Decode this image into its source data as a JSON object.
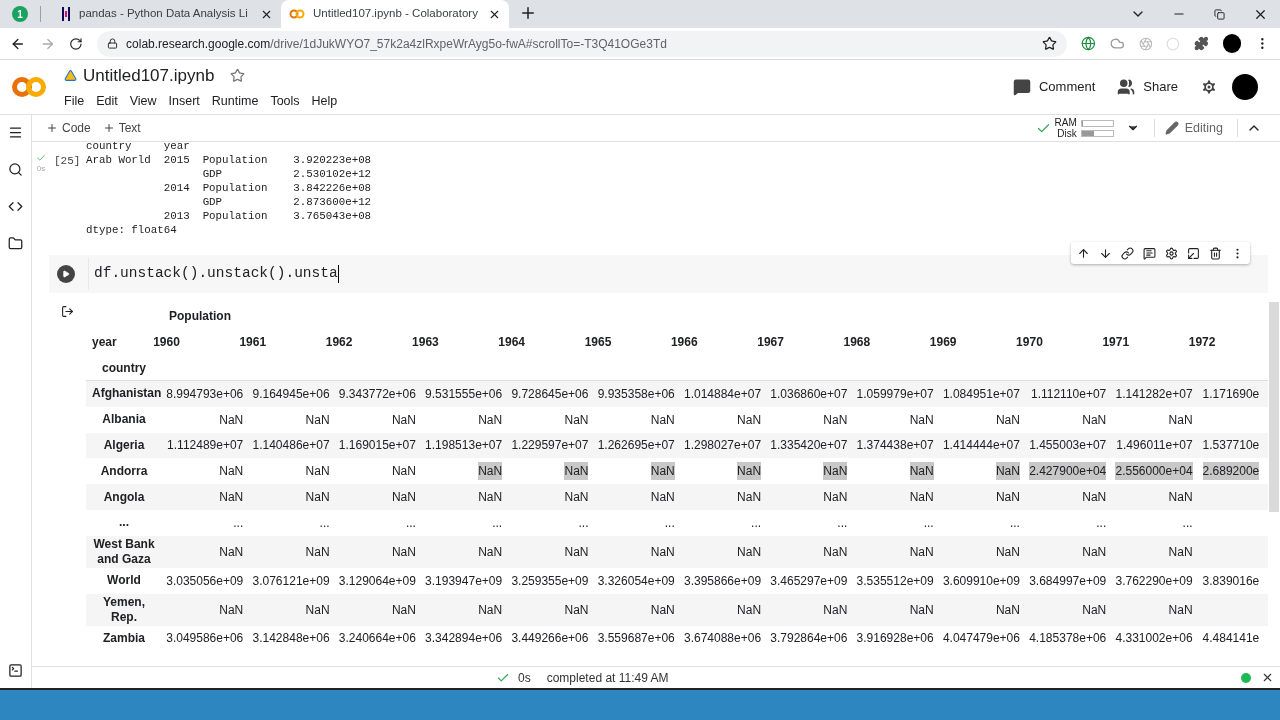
{
  "browser": {
    "pinned_badge": "1",
    "tabs": [
      {
        "title": "pandas - Python Data Analysis Li",
        "selected": false
      },
      {
        "title": "Untitled107.ipynb - Colaboratory",
        "selected": true
      }
    ],
    "url_host": "colab.research.google.com",
    "url_path": "/drive/1dJukWYO7_57k2a4zlRxpeWrAyg5o-fwA#scrollTo=-T3Q41OGe3Td"
  },
  "notebook": {
    "title": "Untitled107.ipynb",
    "menu": [
      "File",
      "Edit",
      "View",
      "Insert",
      "Runtime",
      "Tools",
      "Help"
    ],
    "actions": [
      {
        "kind": "comment",
        "label": "Comment"
      },
      {
        "kind": "share",
        "label": "Share"
      }
    ],
    "add_buttons": [
      {
        "label": "Code"
      },
      {
        "label": "Text"
      }
    ],
    "resources": [
      {
        "label": "RAM",
        "level": 0.05
      },
      {
        "label": "Disk",
        "level": 0.4
      }
    ],
    "mode": "Editing"
  },
  "previous_output": {
    "execution_count": "[25]",
    "duration": "0s",
    "lines": [
      "country     year",
      "Arab World  2015  Population    3.920223e+08",
      "                  GDP           2.530102e+12",
      "            2014  Population    3.842226e+08",
      "                  GDP           2.873600e+12",
      "            2013  Population    3.765043e+08",
      "dtype: float64"
    ]
  },
  "code_cell": {
    "code": "df.unstack().unstack().unsta"
  },
  "table": {
    "top_header": "Population",
    "column_axis": "year",
    "row_axis": "country",
    "columns": [
      "1960",
      "1961",
      "1962",
      "1963",
      "1964",
      "1965",
      "1966",
      "1967",
      "1968",
      "1969",
      "1970",
      "1971",
      "1972"
    ],
    "rows": [
      {
        "label": "Afghanistan",
        "cells": [
          "8.994793e+06",
          "9.164945e+06",
          "9.343772e+06",
          "9.531555e+06",
          "9.728645e+06",
          "9.935358e+06",
          "1.014884e+07",
          "1.036860e+07",
          "1.059979e+07",
          "1.084951e+07",
          "1.112110e+07",
          "1.141282e+07",
          "1.171690e"
        ],
        "highlighted": [
          false,
          false,
          false,
          false,
          false,
          false,
          false,
          false,
          false,
          false,
          false,
          false,
          false
        ]
      },
      {
        "label": "Albania",
        "cells": [
          "NaN",
          "NaN",
          "NaN",
          "NaN",
          "NaN",
          "NaN",
          "NaN",
          "NaN",
          "NaN",
          "NaN",
          "NaN",
          "NaN"
        ],
        "highlighted": [
          false,
          false,
          false,
          false,
          false,
          false,
          false,
          false,
          false,
          false,
          false,
          false
        ]
      },
      {
        "label": "Algeria",
        "cells": [
          "1.112489e+07",
          "1.140486e+07",
          "1.169015e+07",
          "1.198513e+07",
          "1.229597e+07",
          "1.262695e+07",
          "1.298027e+07",
          "1.335420e+07",
          "1.374438e+07",
          "1.414444e+07",
          "1.455003e+07",
          "1.496011e+07",
          "1.537710e"
        ],
        "highlighted": [
          false,
          false,
          false,
          false,
          false,
          false,
          false,
          false,
          false,
          false,
          false,
          false,
          false
        ]
      },
      {
        "label": "Andorra",
        "cells": [
          "NaN",
          "NaN",
          "NaN",
          "NaN",
          "NaN",
          "NaN",
          "NaN",
          "NaN",
          "NaN",
          "NaN",
          "2.427900e+04",
          "2.556000e+04",
          "2.689200e"
        ],
        "highlighted": [
          false,
          false,
          false,
          true,
          true,
          true,
          true,
          true,
          true,
          true,
          true,
          true,
          true
        ]
      },
      {
        "label": "Angola",
        "cells": [
          "NaN",
          "NaN",
          "NaN",
          "NaN",
          "NaN",
          "NaN",
          "NaN",
          "NaN",
          "NaN",
          "NaN",
          "NaN",
          "NaN"
        ],
        "highlighted": [
          false,
          false,
          false,
          false,
          false,
          false,
          false,
          false,
          false,
          false,
          false,
          false
        ]
      },
      {
        "label": "...",
        "cells": [
          "...",
          "...",
          "...",
          "...",
          "...",
          "...",
          "...",
          "...",
          "...",
          "...",
          "...",
          "..."
        ],
        "highlighted": [
          false,
          false,
          false,
          false,
          false,
          false,
          false,
          false,
          false,
          false,
          false,
          false
        ]
      },
      {
        "label": "West Bank and Gaza",
        "cells": [
          "NaN",
          "NaN",
          "NaN",
          "NaN",
          "NaN",
          "NaN",
          "NaN",
          "NaN",
          "NaN",
          "NaN",
          "NaN",
          "NaN"
        ],
        "highlighted": [
          false,
          false,
          false,
          false,
          false,
          false,
          false,
          false,
          false,
          false,
          false,
          false
        ]
      },
      {
        "label": "World",
        "cells": [
          "3.035056e+09",
          "3.076121e+09",
          "3.129064e+09",
          "3.193947e+09",
          "3.259355e+09",
          "3.326054e+09",
          "3.395866e+09",
          "3.465297e+09",
          "3.535512e+09",
          "3.609910e+09",
          "3.684997e+09",
          "3.762290e+09",
          "3.839016e"
        ],
        "highlighted": [
          false,
          false,
          false,
          false,
          false,
          false,
          false,
          false,
          false,
          false,
          false,
          false,
          false
        ]
      },
      {
        "label": "Yemen, Rep.",
        "cells": [
          "NaN",
          "NaN",
          "NaN",
          "NaN",
          "NaN",
          "NaN",
          "NaN",
          "NaN",
          "NaN",
          "NaN",
          "NaN",
          "NaN"
        ],
        "highlighted": [
          false,
          false,
          false,
          false,
          false,
          false,
          false,
          false,
          false,
          false,
          false,
          false
        ]
      },
      {
        "label": "Zambia",
        "cells": [
          "3.049586e+06",
          "3.142848e+06",
          "3.240664e+06",
          "3.342894e+06",
          "3.449266e+06",
          "3.559687e+06",
          "3.674088e+06",
          "3.792864e+06",
          "3.916928e+06",
          "4.047479e+06",
          "4.185378e+06",
          "4.331002e+06",
          "4.484141e"
        ],
        "highlighted": [
          false,
          false,
          false,
          false,
          false,
          false,
          false,
          false,
          false,
          false,
          false,
          false,
          false
        ]
      }
    ]
  },
  "status_bar": {
    "duration": "0s",
    "message": "completed at 11:49 AM"
  }
}
